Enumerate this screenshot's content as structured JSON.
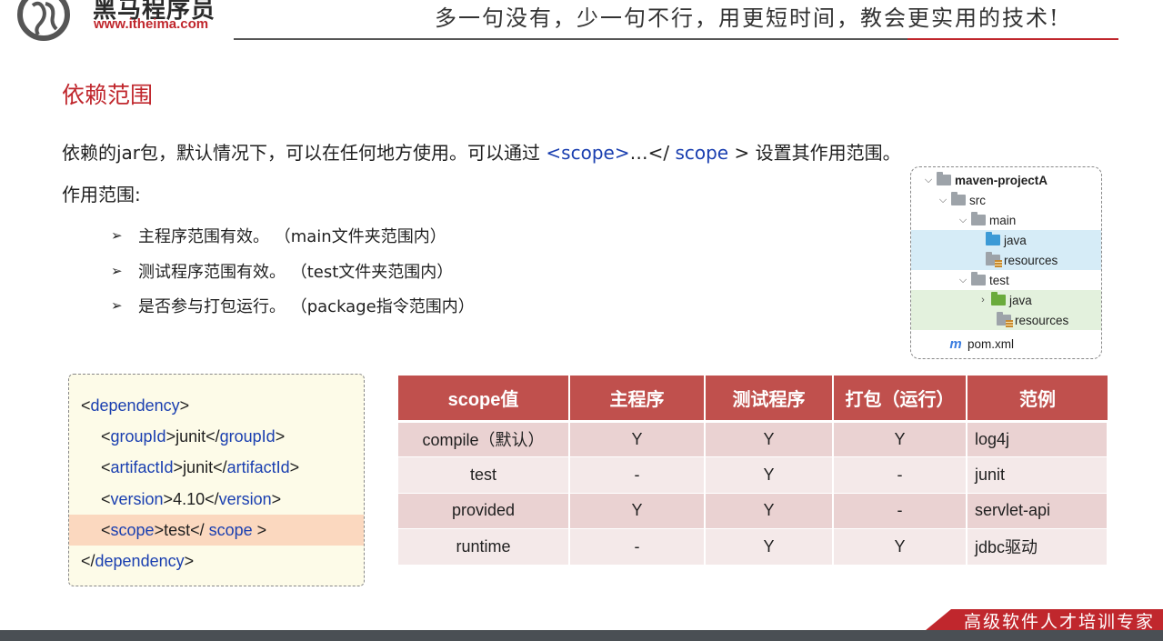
{
  "header": {
    "logo_name": "黑马程序员",
    "logo_url": "www.itheima.com",
    "slogan": "多一句没有，少一句不行，用更短时间，教会更实用的技术!"
  },
  "section_title": "依赖范围",
  "intro": {
    "before": "依赖的jar包，默认情况下，可以在任何地方使用。可以通过 ",
    "tag_open": "<scope>",
    "middle": "…</ ",
    "tag_close": "scope",
    "after": " > 设置其作用范围。"
  },
  "scope_label": "作用范围:",
  "bullets": [
    "主程序范围有效。 （main文件夹范围内）",
    "测试程序范围有效。 （test文件夹范围内）",
    "是否参与打包运行。 （package指令范围内）"
  ],
  "tree": {
    "project": "maven-projectA",
    "src": "src",
    "main": "main",
    "main_java": "java",
    "main_resources": "resources",
    "test": "test",
    "test_java": "java",
    "test_resources": "resources",
    "pom": "pom.xml",
    "pom_icon": "m"
  },
  "code": {
    "l1_tag": "<dependency>",
    "l2_open": "groupId",
    "l2_value": "junit",
    "l2_close": "groupId",
    "l3_open": "artifactId",
    "l3_value": "junit",
    "l3_close": "artifactId",
    "l4_open": "version",
    "l4_value": "4.10",
    "l4_close": "version",
    "l5_open": "scope",
    "l5_value": "test",
    "l5_close": " scope ",
    "l6_close": "dependency"
  },
  "table": {
    "headers": [
      "scope值",
      "主程序",
      "测试程序",
      "打包（运行）",
      "范例"
    ],
    "rows": [
      [
        "compile（默认）",
        "Y",
        "Y",
        "Y",
        "log4j"
      ],
      [
        "test",
        "-",
        "Y",
        "-",
        "junit"
      ],
      [
        "provided",
        "Y",
        "Y",
        "-",
        "servlet-api"
      ],
      [
        "runtime",
        "-",
        "Y",
        "Y",
        "jdbc驱动"
      ]
    ]
  },
  "footer": {
    "text": "高级软件人才培训专家"
  },
  "colors": {
    "brand_red": "#c0272d",
    "keyword_blue": "#1a3fb0",
    "table_header": "#c0504d"
  }
}
